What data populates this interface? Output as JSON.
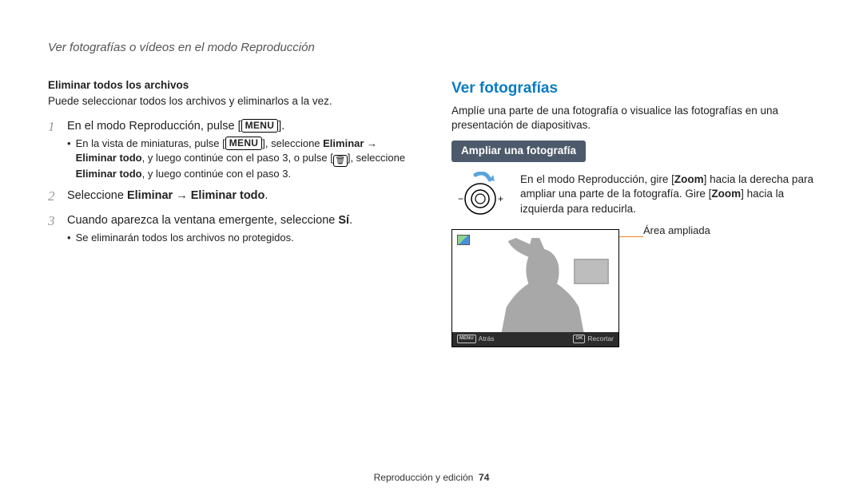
{
  "header": "Ver fotografías o vídeos en el modo Reproducción",
  "left": {
    "subhead": "Eliminar todos los archivos",
    "intro": "Puede seleccionar todos los archivos y eliminarlos a la vez.",
    "step1_a": "En el modo Reproducción, pulse [",
    "step1_b": "].",
    "step1_bullet_a": "En la vista de miniaturas, pulse [",
    "step1_bullet_b": "], seleccione ",
    "step1_bullet_c": " → ",
    "step1_bullet_d": ", y luego continúe con el paso 3, o pulse [",
    "step1_bullet_e": "], seleccione ",
    "step1_bullet_f": ", y luego continúe con el paso 3.",
    "bold_eliminar": "Eliminar",
    "bold_eliminar_todo": "Eliminar todo",
    "step2_a": "Seleccione ",
    "step2_b": " → ",
    "step2_c": ".",
    "step3_a": "Cuando aparezca la ventana emergente, seleccione ",
    "bold_si": "Sí",
    "step3_b": ".",
    "step3_bullet": "Se eliminarán todos los archivos no protegidos.",
    "menu_label": "MENU",
    "trash_label": "🗑"
  },
  "right": {
    "title": "Ver fotografías",
    "intro": "Amplíe una parte de una fotografía o visualice las fotografías en una presentación de diapositivas.",
    "pill": "Ampliar una fotografía",
    "zoom_text_a": "En el modo Reproducción, gire [",
    "zoom_text_b": "] hacia la derecha para ampliar una parte de la fotografía. Gire [",
    "zoom_text_c": "] hacia la izquierda para reducirla.",
    "bold_zoom": "Zoom",
    "callout": "Área ampliada",
    "footer_back": "Atrás",
    "footer_crop": "Recortar",
    "footer_menu": "MENU",
    "footer_ok": "OK"
  },
  "footer": {
    "section": "Reproducción y edición",
    "page": "74"
  }
}
